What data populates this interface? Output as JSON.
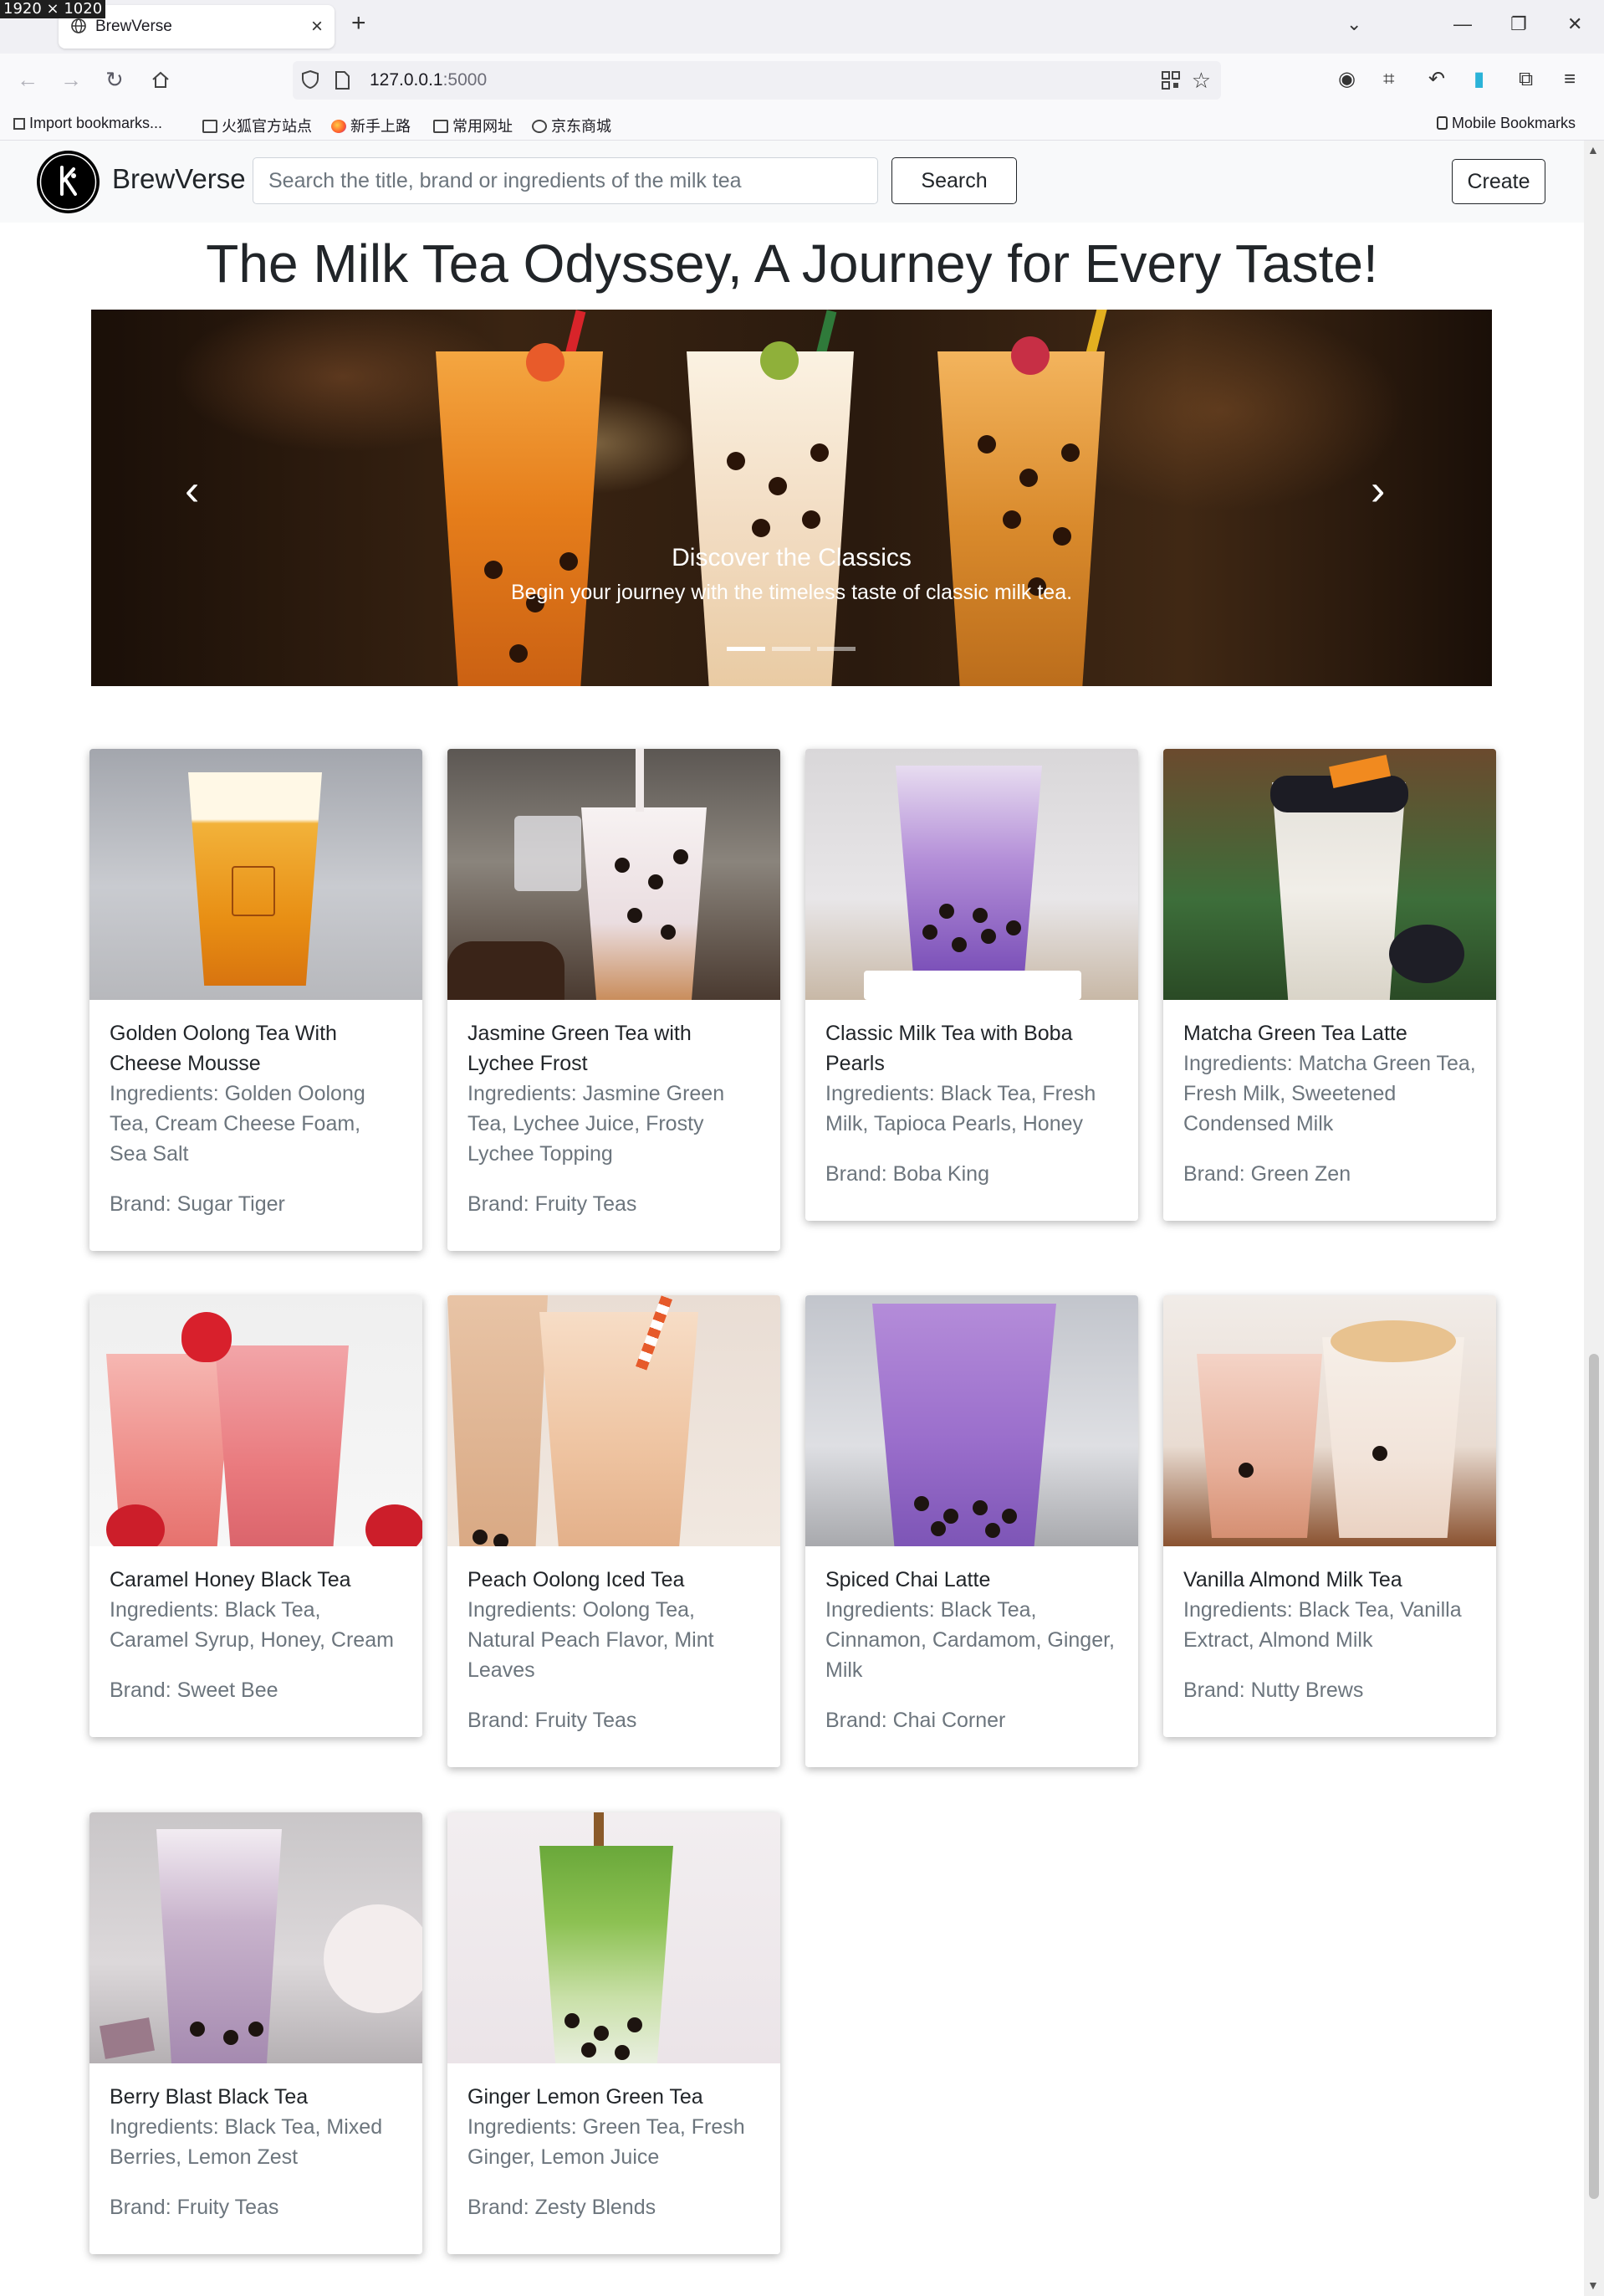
{
  "screen_size_label": "1920 × 1020",
  "browser": {
    "tab_title": "BrewVerse",
    "url_host": "127.0.0.1",
    "url_port": ":5000",
    "bookmarks": [
      "Import bookmarks...",
      "火狐官方站点",
      "新手上路",
      "常用网址",
      "京东商城"
    ],
    "mobile_bookmarks": "Mobile Bookmarks"
  },
  "navbar": {
    "brand": "BrewVerse",
    "search_placeholder": "Search the title, brand or ingredients of the milk tea",
    "search_button": "Search",
    "create_button": "Create"
  },
  "hero": {
    "title": "The Milk Tea Odyssey, A Journey for Every Taste!",
    "slide_title": "Discover the Classics",
    "slide_text": "Begin your journey with the timeless taste of classic milk tea.",
    "slide_count": 3,
    "active_slide": 1
  },
  "teas": [
    {
      "name": "Golden Oolong Tea With Cheese Mousse",
      "ingredients": "Ingredients: Golden Oolong Tea, Cream Cheese Foam, Sea Salt",
      "brand": "Brand: Sugar Tiger"
    },
    {
      "name": "Jasmine Green Tea with Lychee Frost",
      "ingredients": "Ingredients: Jasmine Green Tea, Lychee Juice, Frosty Lychee Topping",
      "brand": "Brand: Fruity Teas"
    },
    {
      "name": "Classic Milk Tea with Boba Pearls",
      "ingredients": "Ingredients: Black Tea, Fresh Milk, Tapioca Pearls, Honey",
      "brand": "Brand: Boba King"
    },
    {
      "name": "Matcha Green Tea Latte",
      "ingredients": "Ingredients: Matcha Green Tea, Fresh Milk, Sweetened Condensed Milk",
      "brand": "Brand: Green Zen"
    },
    {
      "name": "Caramel Honey Black Tea",
      "ingredients": "Ingredients: Black Tea, Caramel Syrup, Honey, Cream",
      "brand": "Brand: Sweet Bee"
    },
    {
      "name": "Peach Oolong Iced Tea",
      "ingredients": "Ingredients: Oolong Tea, Natural Peach Flavor, Mint Leaves",
      "brand": "Brand: Fruity Teas"
    },
    {
      "name": "Spiced Chai Latte",
      "ingredients": "Ingredients: Black Tea, Cinnamon, Cardamom, Ginger, Milk",
      "brand": "Brand: Chai Corner"
    },
    {
      "name": "Vanilla Almond Milk Tea",
      "ingredients": "Ingredients: Black Tea, Vanilla Extract, Almond Milk",
      "brand": "Brand: Nutty Brews"
    },
    {
      "name": "Berry Blast Black Tea",
      "ingredients": "Ingredients: Black Tea, Mixed Berries, Lemon Zest",
      "brand": "Brand: Fruity Teas"
    },
    {
      "name": "Ginger Lemon Green Tea",
      "ingredients": "Ingredients: Green Tea, Fresh Ginger, Lemon Juice",
      "brand": "Brand: Zesty Blends"
    }
  ],
  "icons": {
    "back": "arrow-left-icon",
    "forward": "arrow-right-icon",
    "reload": "reload-icon",
    "home": "home-icon",
    "carousel_prev": "chevron-left-icon",
    "carousel_next": "chevron-right-icon"
  }
}
